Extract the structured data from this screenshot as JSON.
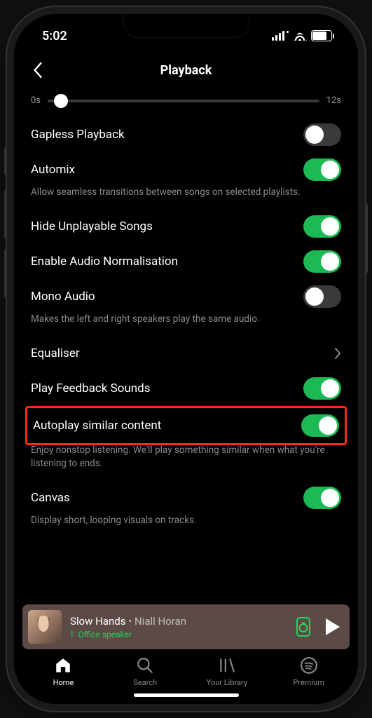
{
  "status": {
    "time": "5:02",
    "battery": "73"
  },
  "header": {
    "title": "Playback"
  },
  "slider": {
    "min": "0s",
    "max": "12s"
  },
  "settings": {
    "gapless": {
      "label": "Gapless Playback",
      "on": false
    },
    "automix": {
      "label": "Automix",
      "on": true,
      "desc": "Allow seamless transitions between songs on selected playlists."
    },
    "hide": {
      "label": "Hide Unplayable Songs",
      "on": true
    },
    "normalise": {
      "label": "Enable Audio Normalisation",
      "on": true
    },
    "mono": {
      "label": "Mono Audio",
      "on": false,
      "desc": "Makes the left and right speakers play the same audio."
    },
    "equaliser": {
      "label": "Equaliser"
    },
    "feedback": {
      "label": "Play Feedback Sounds",
      "on": true
    },
    "autoplay": {
      "label": "Autoplay similar content",
      "on": true,
      "desc": "Enjoy nonstop listening. We'll play something similar when what you're listening to ends."
    },
    "canvas": {
      "label": "Canvas",
      "on": true,
      "desc": "Display short, looping visuals on tracks."
    }
  },
  "nowplaying": {
    "track": "Slow Hands",
    "separator": " • ",
    "artist": "Niall Horan",
    "device": "Office speaker"
  },
  "tabs": {
    "home": "Home",
    "search": "Search",
    "library": "Your Library",
    "premium": "Premium"
  }
}
